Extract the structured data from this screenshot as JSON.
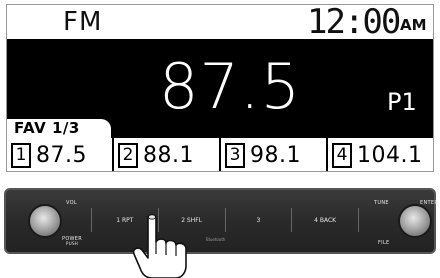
{
  "screen": {
    "band": "FM",
    "clock": {
      "time": "12:00",
      "ampm": "AM"
    },
    "frequency": "87.5",
    "preset_tag": "P1",
    "fav_label": "FAV 1/3",
    "presets": [
      {
        "num": "1",
        "freq": "87.5"
      },
      {
        "num": "2",
        "freq": "88.1"
      },
      {
        "num": "3",
        "freq": "98.1"
      },
      {
        "num": "4",
        "freq": "104.1"
      }
    ]
  },
  "panel": {
    "vol_label": "VOL",
    "power_label": "POWER",
    "push_label": "PUSH",
    "tune_label": "TUNE",
    "enter_label": "ENTER",
    "file_label": "FILE",
    "buttons": [
      "1 RPT",
      "2 SHFL",
      "3",
      "4 BACK"
    ],
    "bluetooth_label": "Bluetooth"
  }
}
